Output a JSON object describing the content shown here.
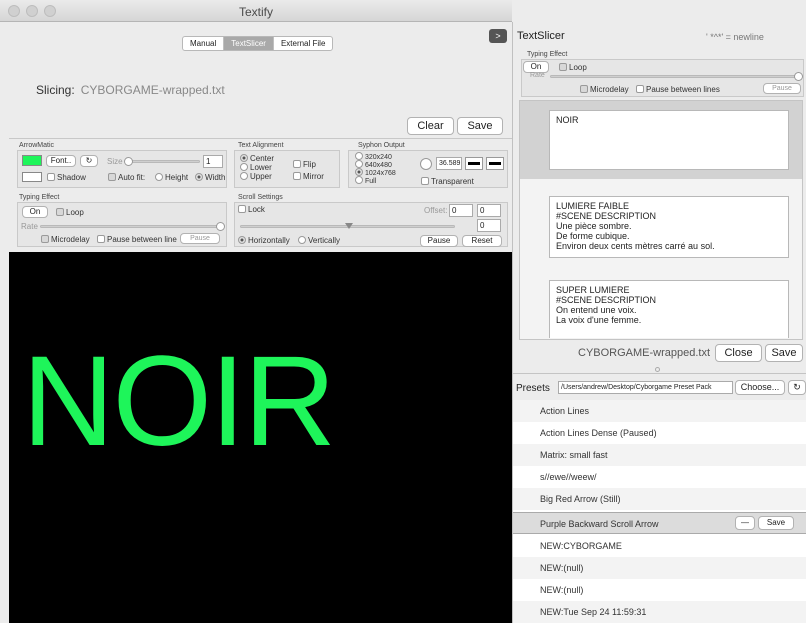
{
  "window": {
    "title": "Textify"
  },
  "top_tabs": [
    "Manual",
    "TextSlicer",
    "External File"
  ],
  "arrow_button": ">",
  "slicing": {
    "label": "Slicing:",
    "file": "CYBORGAME-wrapped.txt"
  },
  "buttons": {
    "clear": "Clear",
    "save": "Save"
  },
  "arrowmatic": {
    "title": "ArrowMatic",
    "font": "Font..",
    "refresh": "↻",
    "size_label": "Size",
    "size_value": "1",
    "shadow": "Shadow",
    "auto_fit": "Auto fit:",
    "height": "Height",
    "width": "Width",
    "swatch_color": "#1ef55a"
  },
  "text_alignment": {
    "title": "Text Alignment",
    "center": "Center",
    "lower": "Lower",
    "upper": "Upper",
    "flip": "Flip",
    "mirror": "Mirror"
  },
  "syphon": {
    "title": "Syphon Output",
    "res1": "320x240",
    "res2": "640x480",
    "res3": "1024x768",
    "res4": "Full",
    "value": "36.589",
    "transparent": "Transparent"
  },
  "typing_effect": {
    "title": "Typing Effect",
    "on": "On",
    "loop": "Loop",
    "rate": "Rate",
    "microdelay": "Microdelay",
    "pause_between": "Pause between lines",
    "pause_btn": "Pause"
  },
  "scroll": {
    "title": "Scroll Settings",
    "lock": "Lock",
    "offset": "Offset:",
    "offset_x": "0",
    "offset_y": "0",
    "third": "0",
    "horizontally": "Horizontally",
    "vertically": "Vertically",
    "pause": "Pause",
    "reset": "Reset"
  },
  "preview_text": "NOIR",
  "textslicer": {
    "title": "TextSlicer",
    "newline_hint": "' *^*' = newline",
    "typing_title": "Typing Effect",
    "on": "On",
    "loop": "Loop",
    "rate": "Rate",
    "microdelay": "Microdelay",
    "pause_between": "Pause between lines",
    "pause_btn": "Pause",
    "slices": [
      {
        "lines": [
          "NOIR"
        ]
      },
      {
        "lines": [
          "LUMIERE FAIBLE",
          "#SCENE DESCRIPTION",
          "Une pièce sombre.",
          "De forme cubique.",
          "Environ deux cents mètres carré au sol."
        ]
      },
      {
        "lines": [
          "SUPER LUMIERE",
          "#SCENE DESCRIPTION",
          "On entend une voix.",
          "La voix d'une femme."
        ]
      }
    ],
    "file": "CYBORGAME-wrapped.txt",
    "close": "Close",
    "save": "Save"
  },
  "presets": {
    "label": "Presets",
    "path": "/Users/andrew/Desktop/Cyborgame Preset Pack",
    "choose": "Choose...",
    "refresh": "↻",
    "items": [
      "Action Lines",
      "Action Lines Dense (Paused)",
      "Matrix: small fast",
      "s//ewe//weew/",
      "Big Red Arrow (Still)",
      "Purple Backward Scroll Arrow",
      "NEW:CYBORGAME",
      "NEW:(null)",
      "NEW:(null)",
      "NEW:Tue Sep 24 11:59:31"
    ],
    "selected_index": 5,
    "minus": "—",
    "save": "Save"
  }
}
